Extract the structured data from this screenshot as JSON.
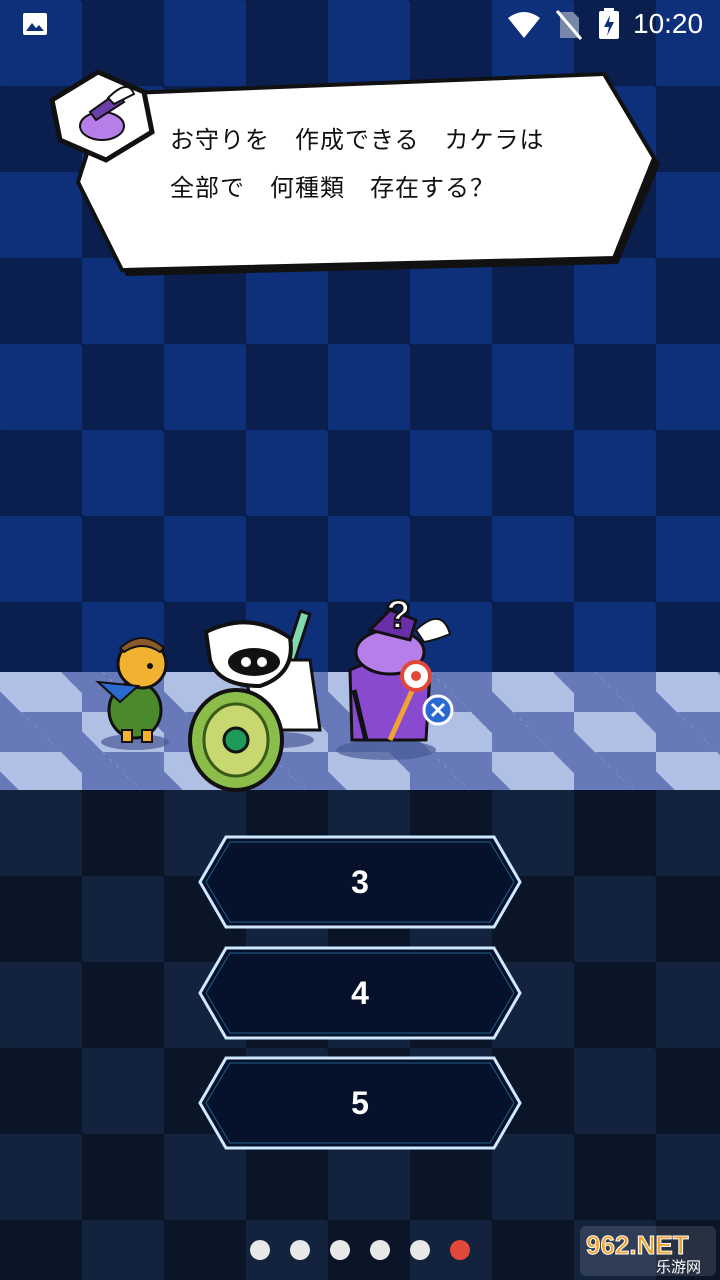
{
  "status_bar": {
    "time": "10:20"
  },
  "dialog": {
    "question": "お守りを　作成できる　カケラは\n全部で　何種類　存在する？"
  },
  "answers": [
    {
      "label": "3"
    },
    {
      "label": "4"
    },
    {
      "label": "5"
    }
  ],
  "pagination": {
    "total": 6,
    "active": 6
  },
  "watermark": {
    "text_top": "962.NET",
    "text_bottom": "乐游网"
  },
  "colors": {
    "accent": "#e2483a",
    "answer_bg": "#06122b",
    "answer_border": "#cfe8ff"
  }
}
